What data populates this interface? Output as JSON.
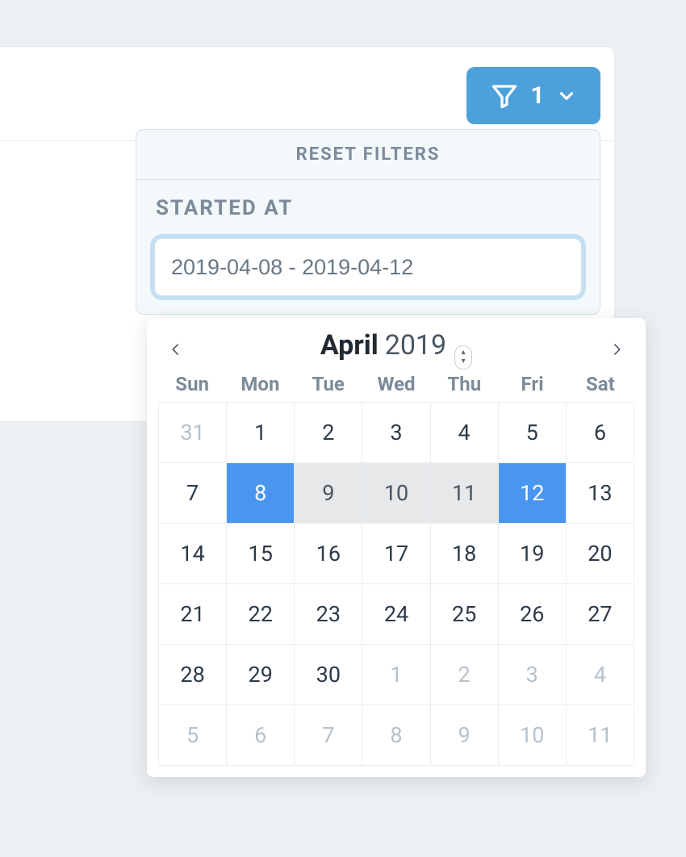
{
  "filter": {
    "count": "1",
    "reset_label": "RESET FILTERS",
    "section_label": "STARTED AT",
    "range_value": "2019-04-08 - 2019-04-12"
  },
  "datepicker": {
    "month": "April",
    "year": "2019",
    "dow": [
      "Sun",
      "Mon",
      "Tue",
      "Wed",
      "Thu",
      "Fri",
      "Sat"
    ],
    "days": [
      {
        "d": "31",
        "other": true
      },
      {
        "d": "1"
      },
      {
        "d": "2"
      },
      {
        "d": "3"
      },
      {
        "d": "4"
      },
      {
        "d": "5"
      },
      {
        "d": "6"
      },
      {
        "d": "7"
      },
      {
        "d": "8",
        "sel": "end"
      },
      {
        "d": "9",
        "sel": "range"
      },
      {
        "d": "10",
        "sel": "range"
      },
      {
        "d": "11",
        "sel": "range"
      },
      {
        "d": "12",
        "sel": "end"
      },
      {
        "d": "13"
      },
      {
        "d": "14"
      },
      {
        "d": "15"
      },
      {
        "d": "16"
      },
      {
        "d": "17"
      },
      {
        "d": "18"
      },
      {
        "d": "19"
      },
      {
        "d": "20"
      },
      {
        "d": "21"
      },
      {
        "d": "22"
      },
      {
        "d": "23"
      },
      {
        "d": "24"
      },
      {
        "d": "25"
      },
      {
        "d": "26"
      },
      {
        "d": "27"
      },
      {
        "d": "28"
      },
      {
        "d": "29"
      },
      {
        "d": "30"
      },
      {
        "d": "1",
        "other": true
      },
      {
        "d": "2",
        "other": true
      },
      {
        "d": "3",
        "other": true
      },
      {
        "d": "4",
        "other": true
      },
      {
        "d": "5",
        "other": true
      },
      {
        "d": "6",
        "other": true
      },
      {
        "d": "7",
        "other": true
      },
      {
        "d": "8",
        "other": true
      },
      {
        "d": "9",
        "other": true
      },
      {
        "d": "10",
        "other": true
      },
      {
        "d": "11",
        "other": true
      }
    ]
  },
  "colors": {
    "accent": "#4da1db",
    "select": "#4a96ee"
  }
}
